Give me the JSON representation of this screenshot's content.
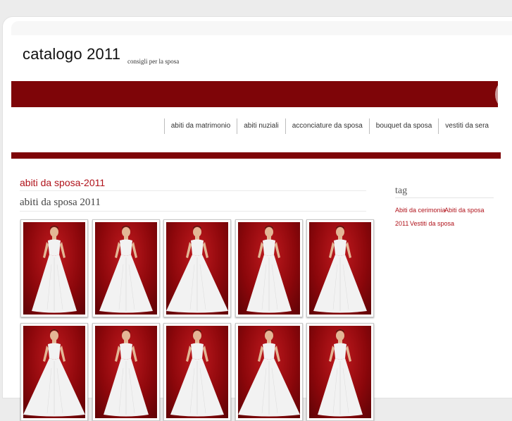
{
  "site": {
    "title": "catalogo 2011",
    "tagline": "consigli per la sposa"
  },
  "nav": {
    "items": [
      {
        "label": "abiti da matrimonio"
      },
      {
        "label": "abiti nuziali"
      },
      {
        "label": "acconciature da sposa"
      },
      {
        "label": "bouquet da sposa"
      },
      {
        "label": "vestiti da sera"
      }
    ]
  },
  "post": {
    "title": "abiti da sposa-2011",
    "subtitle": "abiti da sposa 2011",
    "gallery_count": 10
  },
  "sidebar": {
    "heading": "tag",
    "tags": [
      {
        "label": "Abiti da cerimonia"
      },
      {
        "label": "Abiti da sposa"
      },
      {
        "label": "2011"
      },
      {
        "label": "Vestiti da sposa"
      }
    ]
  },
  "colors": {
    "brand_red": "#7e0508",
    "link_red": "#b0121a",
    "photo_backdrop": "#a00d12",
    "dress_white": "#f2f2f2"
  }
}
